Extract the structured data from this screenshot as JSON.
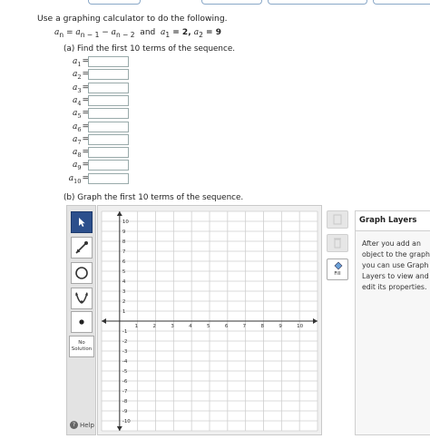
{
  "instructions": "Use a graphing calculator to do the following.",
  "formula": {
    "lhs": "a",
    "lhs_sub": "n",
    "eq": " = ",
    "term1": "a",
    "term1_sub": "n − 1",
    "minus": " − ",
    "term2": "a",
    "term2_sub": "n − 2",
    "and": "  and  ",
    "init1": "a",
    "init1_sub": "1",
    "init1_val": " = 2, ",
    "init2": "a",
    "init2_sub": "2",
    "init2_val": " = 9"
  },
  "part_a": "(a) Find the first 10 terms of the sequence.",
  "terms": [
    {
      "var": "a",
      "sub": "1",
      "value": ""
    },
    {
      "var": "a",
      "sub": "2",
      "value": ""
    },
    {
      "var": "a",
      "sub": "3",
      "value": ""
    },
    {
      "var": "a",
      "sub": "4",
      "value": ""
    },
    {
      "var": "a",
      "sub": "5",
      "value": ""
    },
    {
      "var": "a",
      "sub": "6",
      "value": ""
    },
    {
      "var": "a",
      "sub": "7",
      "value": ""
    },
    {
      "var": "a",
      "sub": "8",
      "value": ""
    },
    {
      "var": "a",
      "sub": "9",
      "value": ""
    },
    {
      "var": "a",
      "sub": "10",
      "value": ""
    }
  ],
  "part_b": "(b) Graph the first 10 terms of the sequence.",
  "tools": {
    "no_solution_line1": "No",
    "no_solution_line2": "Solution",
    "help": "Help",
    "fill": "Fill"
  },
  "graph": {
    "x_ticks": [
      "1",
      "2",
      "3",
      "4",
      "5",
      "6",
      "7",
      "8",
      "9",
      "10"
    ],
    "y_ticks": [
      "10",
      "9",
      "8",
      "7",
      "6",
      "5",
      "4",
      "3",
      "2",
      "1",
      "-1",
      "-2",
      "-3",
      "-4",
      "-5",
      "-6",
      "-7",
      "-8",
      "-9",
      "-10"
    ],
    "xlim": [
      -1,
      11
    ],
    "ylim": [
      -11,
      11
    ],
    "grid": true
  },
  "layers": {
    "title": "Graph Layers",
    "hint": "After you add an object to the graph you can use Graph Layers to view and edit its properties."
  }
}
